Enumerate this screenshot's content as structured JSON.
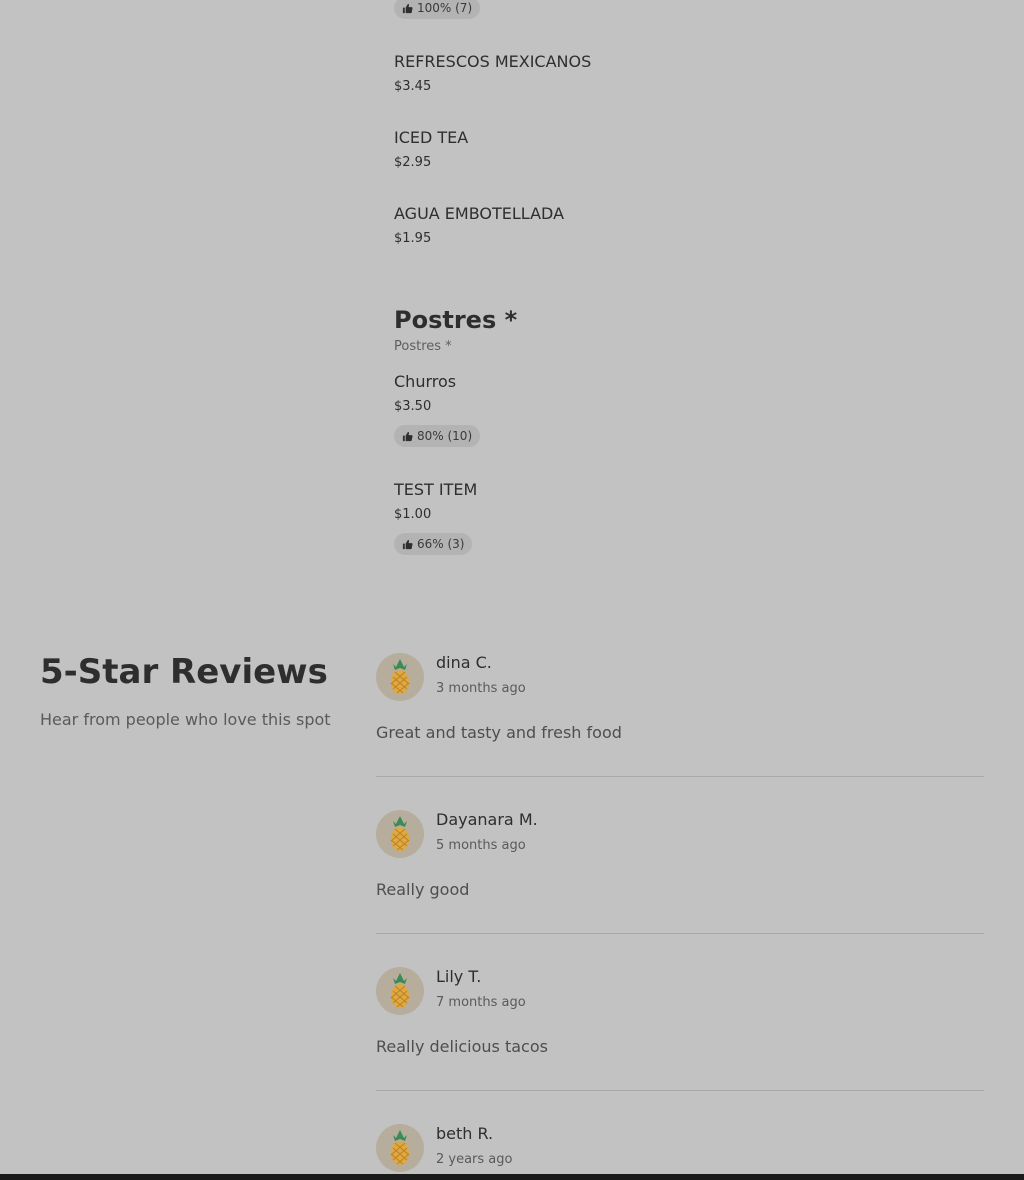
{
  "menu": {
    "top_badge": "100% (7)",
    "drinks": [
      {
        "name": "REFRESCOS MEXICANOS",
        "price": "$3.45"
      },
      {
        "name": "ICED TEA",
        "price": "$2.95"
      },
      {
        "name": "AGUA EMBOTELLADA",
        "price": "$1.95"
      }
    ],
    "postres": {
      "title": "Postres *",
      "subtitle": "Postres *",
      "items": [
        {
          "name": "Churros",
          "price": "$3.50",
          "rating": "80% (10)"
        },
        {
          "name": "TEST ITEM",
          "price": "$1.00",
          "rating": "66% (3)"
        }
      ]
    }
  },
  "reviews": {
    "title": "5-Star Reviews",
    "subtitle": "Hear from people who love this spot",
    "list": [
      {
        "name": "dina C.",
        "time": "3 months ago",
        "text": "Great and tasty and fresh food"
      },
      {
        "name": "Dayanara M.",
        "time": "5 months ago",
        "text": "Really good"
      },
      {
        "name": "Lily T.",
        "time": "7 months ago",
        "text": "Really delicious tacos"
      },
      {
        "name": "beth R.",
        "time": "2 years ago",
        "text": ""
      }
    ]
  },
  "icons": {
    "thumbs_up": "thumbs-up-icon",
    "avatar": "pineapple-icon"
  },
  "colors": {
    "page_bg": "#c2c2c2",
    "badge_bg": "#b3b3b3",
    "avatar_bg": "#b6ad9d"
  }
}
